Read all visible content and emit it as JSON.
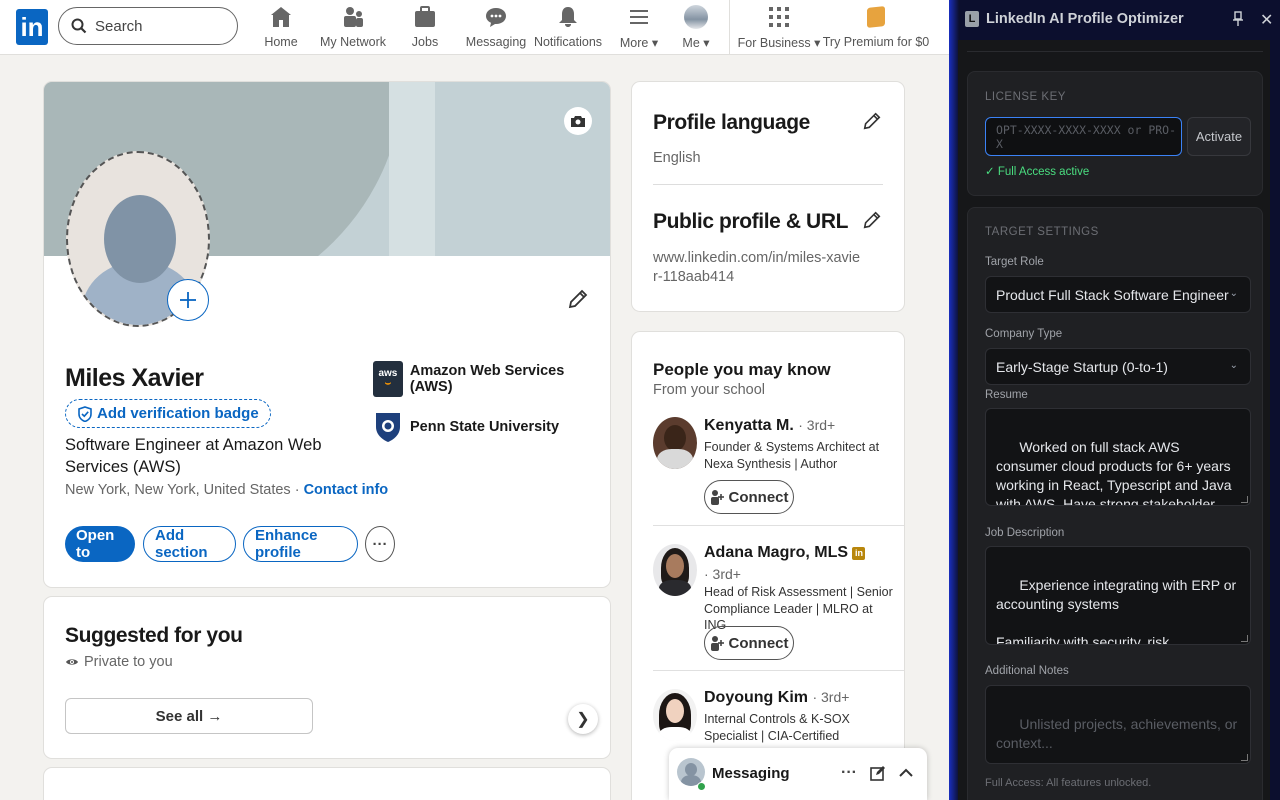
{
  "nav": {
    "search_placeholder": "Search",
    "items": [
      {
        "label": "Home",
        "icon": "home-icon"
      },
      {
        "label": "My Network",
        "icon": "network-icon"
      },
      {
        "label": "Jobs",
        "icon": "briefcase-icon"
      },
      {
        "label": "Messaging",
        "icon": "chat-icon"
      },
      {
        "label": "Notifications",
        "icon": "bell-icon"
      },
      {
        "label": "More",
        "icon": "hamburger-icon"
      },
      {
        "label": "Me",
        "icon": "avatar-icon"
      },
      {
        "label": "For Business",
        "icon": "grid-icon"
      },
      {
        "label": "Try Premium for $0",
        "icon": "premium-icon"
      }
    ],
    "brand_color": "#0a66c2"
  },
  "profile": {
    "name": "Miles Xavier",
    "verify_label": "Add verification badge",
    "headline": "Software Engineer at Amazon Web Services (AWS)",
    "location": "New York, New York, United States",
    "contact_label": "Contact info",
    "orgs": [
      {
        "name": "Amazon Web Services (AWS)",
        "logo": "aws-logo"
      },
      {
        "name": "Penn State University",
        "logo": "penn-state-logo"
      }
    ],
    "buttons": {
      "open_to": "Open to",
      "add_section": "Add section",
      "enhance": "Enhance profile",
      "more": "···"
    }
  },
  "suggested": {
    "title": "Suggested for you",
    "private": "Private to you",
    "see_all": "See all →"
  },
  "sidebar": {
    "lang_title": "Profile language",
    "lang_value": "English",
    "url_title": "Public profile & URL",
    "url_value": "www.linkedin.com/in/miles-xavier-118aab414"
  },
  "pymk": {
    "title": "People you may know",
    "subtitle": "From your school",
    "connect_label": "Connect",
    "people": [
      {
        "name": "Kenyatta M.",
        "degree": "· 3rd+",
        "desc": "Founder & Systems Architect at Nexa Synthesis | Author"
      },
      {
        "name": "Adana Magro, MLS",
        "degree": "· 3rd+",
        "desc": "Head of Risk Assessment | Senior Compliance Leader | MLRO at ING"
      },
      {
        "name": "Doyoung Kim",
        "degree": "· 3rd+",
        "desc": "Internal Controls & K-SOX Specialist | CIA-Certified"
      }
    ]
  },
  "messaging": {
    "label": "Messaging"
  },
  "extension": {
    "title": "LinkedIn AI Profile Optimizer",
    "license_heading": "LICENSE KEY",
    "license_placeholder": "OPT-XXXX-XXXX-XXXX or PRO-X",
    "activate": "Activate",
    "full_access": "✓ Full Access active",
    "target_heading": "TARGET SETTINGS",
    "target_role_label": "Target Role",
    "target_role_value": "Product Full Stack Software Engineer",
    "company_type_label": "Company Type",
    "company_type_value": "Early-Stage Startup (0-to-1)",
    "resume_label": "Resume",
    "resume_text": "Worked on full stack AWS consumer cloud products for 6+ years working in React, Typescript and Java with AWS. Have strong stakeholder management experience while mentoring junior engineers leading projects",
    "jd_label": "Job Description",
    "jd_text": "Experience integrating with ERP or accounting systems\n\nFamiliarity with security, risk,",
    "notes_label": "Additional Notes",
    "notes_placeholder": "Unlisted projects, achievements, or context...",
    "footer": "Full Access: All features unlocked."
  }
}
